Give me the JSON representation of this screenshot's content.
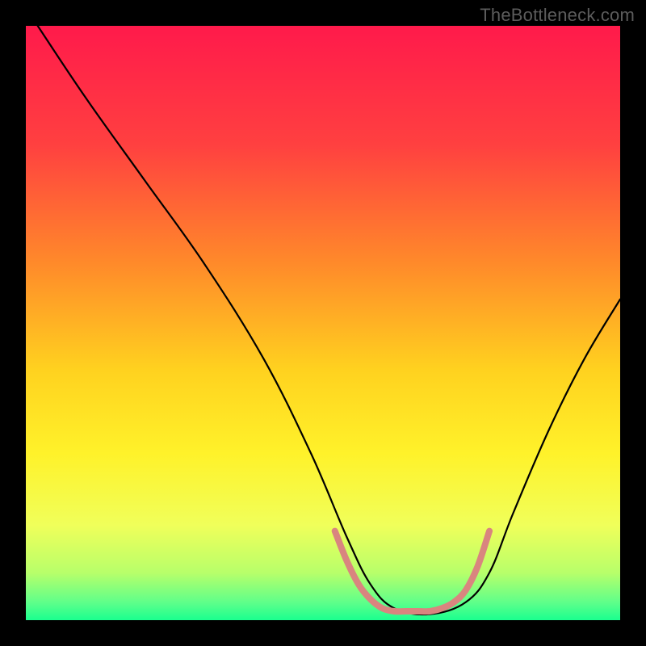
{
  "watermark": {
    "text": "TheBottleneck.com"
  },
  "chart_data": {
    "type": "line",
    "title": "",
    "xlabel": "",
    "ylabel": "",
    "xlim": [
      0,
      100
    ],
    "ylim": [
      0,
      100
    ],
    "gradient_stops": [
      {
        "offset": 0,
        "color": "#ff1a4b"
      },
      {
        "offset": 20,
        "color": "#ff4040"
      },
      {
        "offset": 40,
        "color": "#ff8a2a"
      },
      {
        "offset": 58,
        "color": "#ffd21f"
      },
      {
        "offset": 72,
        "color": "#fff22a"
      },
      {
        "offset": 84,
        "color": "#f0ff5a"
      },
      {
        "offset": 92,
        "color": "#b8ff6a"
      },
      {
        "offset": 97,
        "color": "#5fff8a"
      },
      {
        "offset": 100,
        "color": "#1aff8f"
      }
    ],
    "series": [
      {
        "name": "bottleneck-curve",
        "color": "#000000",
        "width": 2.2,
        "x": [
          2,
          10,
          20,
          30,
          40,
          48,
          54,
          58,
          62,
          68,
          74,
          78,
          82,
          88,
          94,
          100
        ],
        "y": [
          100,
          88,
          74,
          60,
          44,
          28,
          14,
          6,
          2,
          1,
          3,
          8,
          18,
          32,
          44,
          54
        ]
      },
      {
        "name": "optimal-range-marker",
        "color": "#d9857f",
        "width": 8,
        "x": [
          52,
          54,
          56,
          58,
          60,
          62,
          64,
          66,
          68,
          70,
          72,
          74,
          76,
          78
        ],
        "y": [
          15,
          10,
          6,
          3.5,
          2,
          1.5,
          1.5,
          1.5,
          1.5,
          2,
          3,
          5,
          9,
          15
        ]
      }
    ]
  }
}
